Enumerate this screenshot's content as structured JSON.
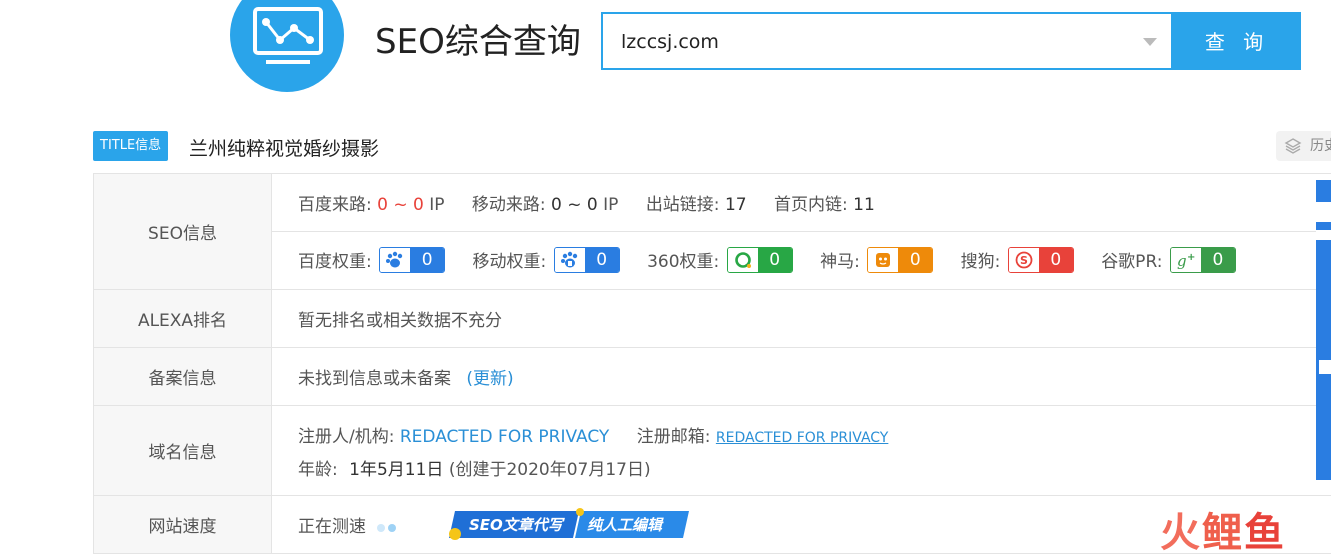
{
  "header": {
    "title": "SEO综合查询",
    "search_value": "lzccsj.com",
    "search_button": "查 询",
    "accent_color": "#2aa4ea"
  },
  "title_info": {
    "tag": "TITLE信息",
    "text": "兰州纯粹视觉婚纱摄影",
    "history_label": "历史"
  },
  "seo": {
    "label": "SEO信息",
    "baidu_traffic_label": "百度来路:",
    "baidu_traffic_value": "0 ~ 0",
    "baidu_traffic_unit": "IP",
    "mobile_traffic_label": "移动来路:",
    "mobile_traffic_value": "0 ~ 0",
    "mobile_traffic_unit": "IP",
    "outlinks_label": "出站链接:",
    "outlinks_value": "17",
    "inlinks_label": "首页内链:",
    "inlinks_value": "11",
    "baidu_weight_label": "百度权重:",
    "baidu_weight_value": "0",
    "mobile_weight_label": "移动权重:",
    "mobile_weight_value": "0",
    "so360_weight_label": "360权重:",
    "so360_weight_value": "0",
    "shenma_label": "神马:",
    "shenma_value": "0",
    "sogou_label": "搜狗:",
    "sogou_value": "0",
    "google_pr_label": "谷歌PR:",
    "google_pr_value": "0"
  },
  "alexa": {
    "label": "ALEXA排名",
    "value": "暂无排名或相关数据不充分"
  },
  "icp": {
    "label": "备案信息",
    "value": "未找到信息或未备案",
    "update_link": "(更新)"
  },
  "domain": {
    "label": "域名信息",
    "registrant_label": "注册人/机构:",
    "registrant_value": "REDACTED FOR PRIVACY",
    "email_label": "注册邮箱:",
    "email_value": "REDACTED FOR PRIVACY",
    "age_label": "年龄:",
    "age_value": "1年5月11日",
    "created_text": "(创建于2020年07月17日)"
  },
  "speed": {
    "label": "网站速度",
    "status": "正在测速"
  },
  "banner": {
    "text_a": "SEO文章代写",
    "text_b": "纯人工编辑"
  },
  "watermark": {
    "a": "火",
    "b": "鲤",
    "c": "鱼"
  }
}
